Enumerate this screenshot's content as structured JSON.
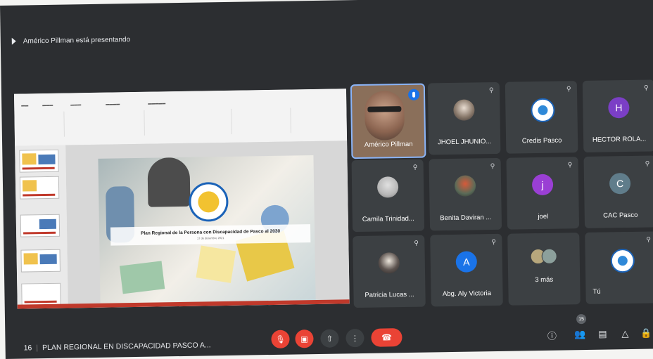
{
  "presenting_text": "Américo Pillman está presentando",
  "slide": {
    "title": "Plan Regional de la Persona con Discapacidad de Pasco al 2030",
    "subtitle": "17 de diciembre 2021"
  },
  "participants": [
    {
      "name": "Américo Pillman",
      "avatar": "photo",
      "speaking": true
    },
    {
      "name": "JHOEL JHUNIO...",
      "avatar": "photo"
    },
    {
      "name": "Credis Pasco",
      "avatar": "logo"
    },
    {
      "name": "HECTOR ROLA...",
      "avatar": "letter",
      "letter": "H",
      "color": "#7b3fc6"
    },
    {
      "name": "Camila Trinidad...",
      "avatar": "photo"
    },
    {
      "name": "Benita Daviran ...",
      "avatar": "photo"
    },
    {
      "name": "joel",
      "avatar": "letter",
      "letter": "j",
      "color": "#9a3fd4"
    },
    {
      "name": "CAC Pasco",
      "avatar": "letter",
      "letter": "C",
      "color": "#607d8b"
    },
    {
      "name": "Patricia Lucas ...",
      "avatar": "photo"
    },
    {
      "name": "Abg. Aly Victoria",
      "avatar": "letter",
      "letter": "A",
      "color": "#1a73e8"
    },
    {
      "name": "3 más",
      "avatar": "stack"
    },
    {
      "name": "Tú",
      "avatar": "logo"
    }
  ],
  "bottom": {
    "time": "16",
    "meeting_name": "PLAN REGIONAL EN DISCAPACIDAD PASCO A...",
    "participants_count": "15"
  },
  "icons": {
    "mic": "mic-off-icon",
    "cam": "cam-off-icon",
    "present": "present-icon",
    "more": "more-icon",
    "hangup": "hangup-icon"
  }
}
